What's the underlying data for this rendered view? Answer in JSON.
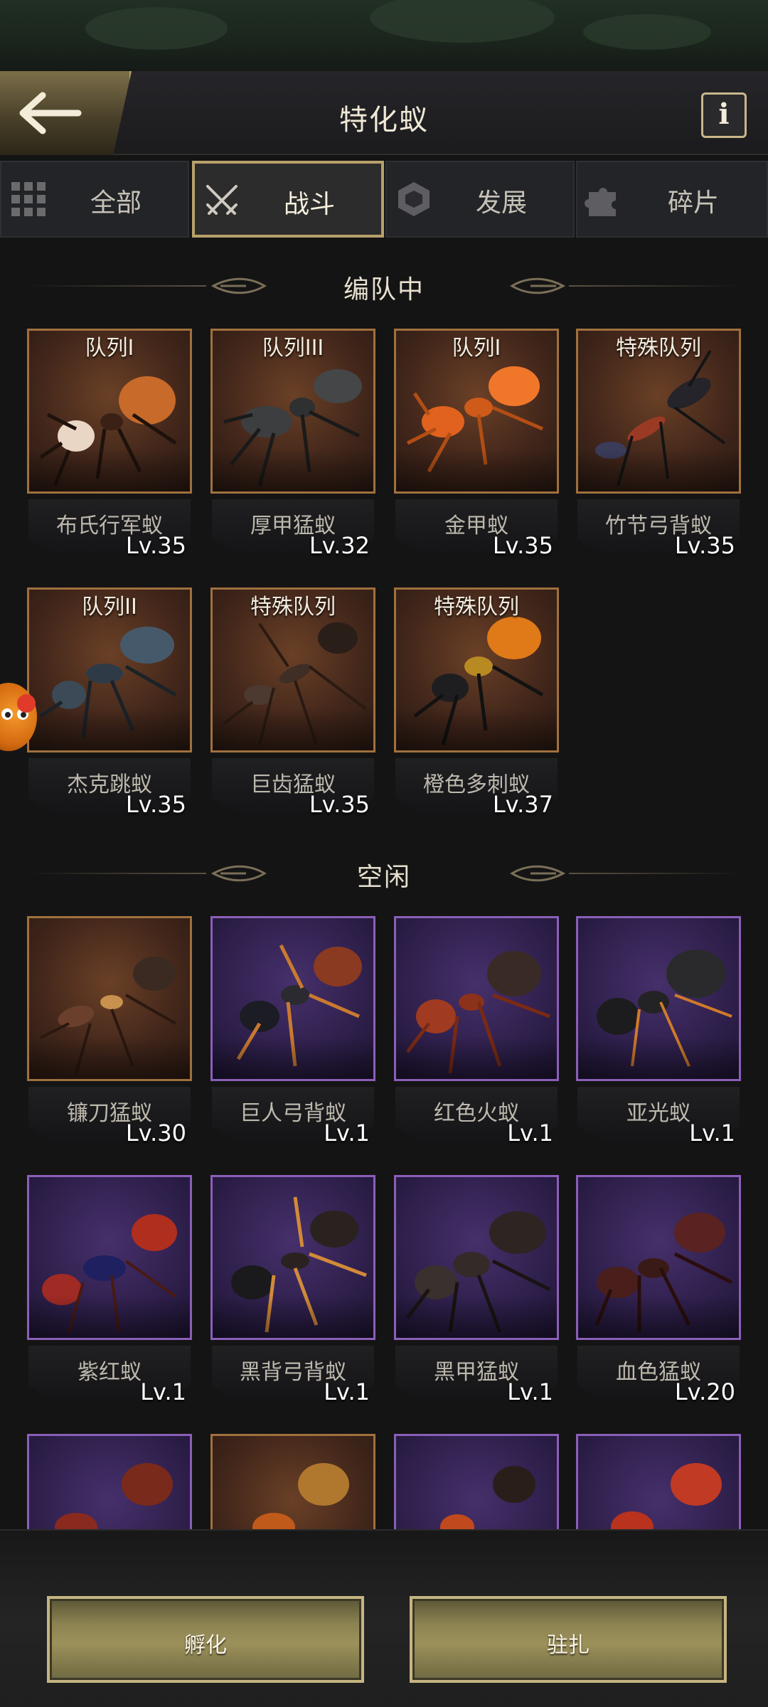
{
  "header": {
    "title": "特化蚁",
    "info_label": "i"
  },
  "tabs": [
    {
      "label": "全部",
      "icon": "grid-icon"
    },
    {
      "label": "战斗",
      "icon": "crossed-swords-icon",
      "active": true
    },
    {
      "label": "发展",
      "icon": "hexagon-build-icon"
    },
    {
      "label": "碎片",
      "icon": "puzzle-piece-icon"
    }
  ],
  "sections": {
    "in_formation": "编队中",
    "idle": "空闲"
  },
  "formation_ants": [
    {
      "row": "队列I",
      "level": "Lv.35",
      "name": "布氏行军蚁"
    },
    {
      "row": "队列III",
      "level": "Lv.32",
      "name": "厚甲猛蚁"
    },
    {
      "row": "队列I",
      "level": "Lv.35",
      "name": "金甲蚁"
    },
    {
      "row": "特殊队列",
      "level": "Lv.35",
      "name": "竹节弓背蚁"
    },
    {
      "row": "队列II",
      "level": "Lv.35",
      "name": "杰克跳蚁"
    },
    {
      "row": "特殊队列",
      "level": "Lv.35",
      "name": "巨齿猛蚁"
    },
    {
      "row": "特殊队列",
      "level": "Lv.37",
      "name": "橙色多刺蚁"
    }
  ],
  "idle_ants": [
    {
      "level": "Lv.30",
      "name": "镰刀猛蚁"
    },
    {
      "level": "Lv.1",
      "name": "巨人弓背蚁"
    },
    {
      "level": "Lv.1",
      "name": "红色火蚁"
    },
    {
      "level": "Lv.1",
      "name": "亚光蚁"
    },
    {
      "level": "Lv.1",
      "name": "紫红蚁"
    },
    {
      "level": "Lv.1",
      "name": "黑背弓背蚁"
    },
    {
      "level": "Lv.1",
      "name": "黑甲猛蚁"
    },
    {
      "level": "Lv.20",
      "name": "血色猛蚁"
    }
  ],
  "buttons": {
    "hatch": "孵化",
    "station": "驻扎"
  },
  "colors": {
    "gold_frame": "#a0703e",
    "purple_frame": "#8a5fb8",
    "active_tab_border": "#b8a06a"
  }
}
